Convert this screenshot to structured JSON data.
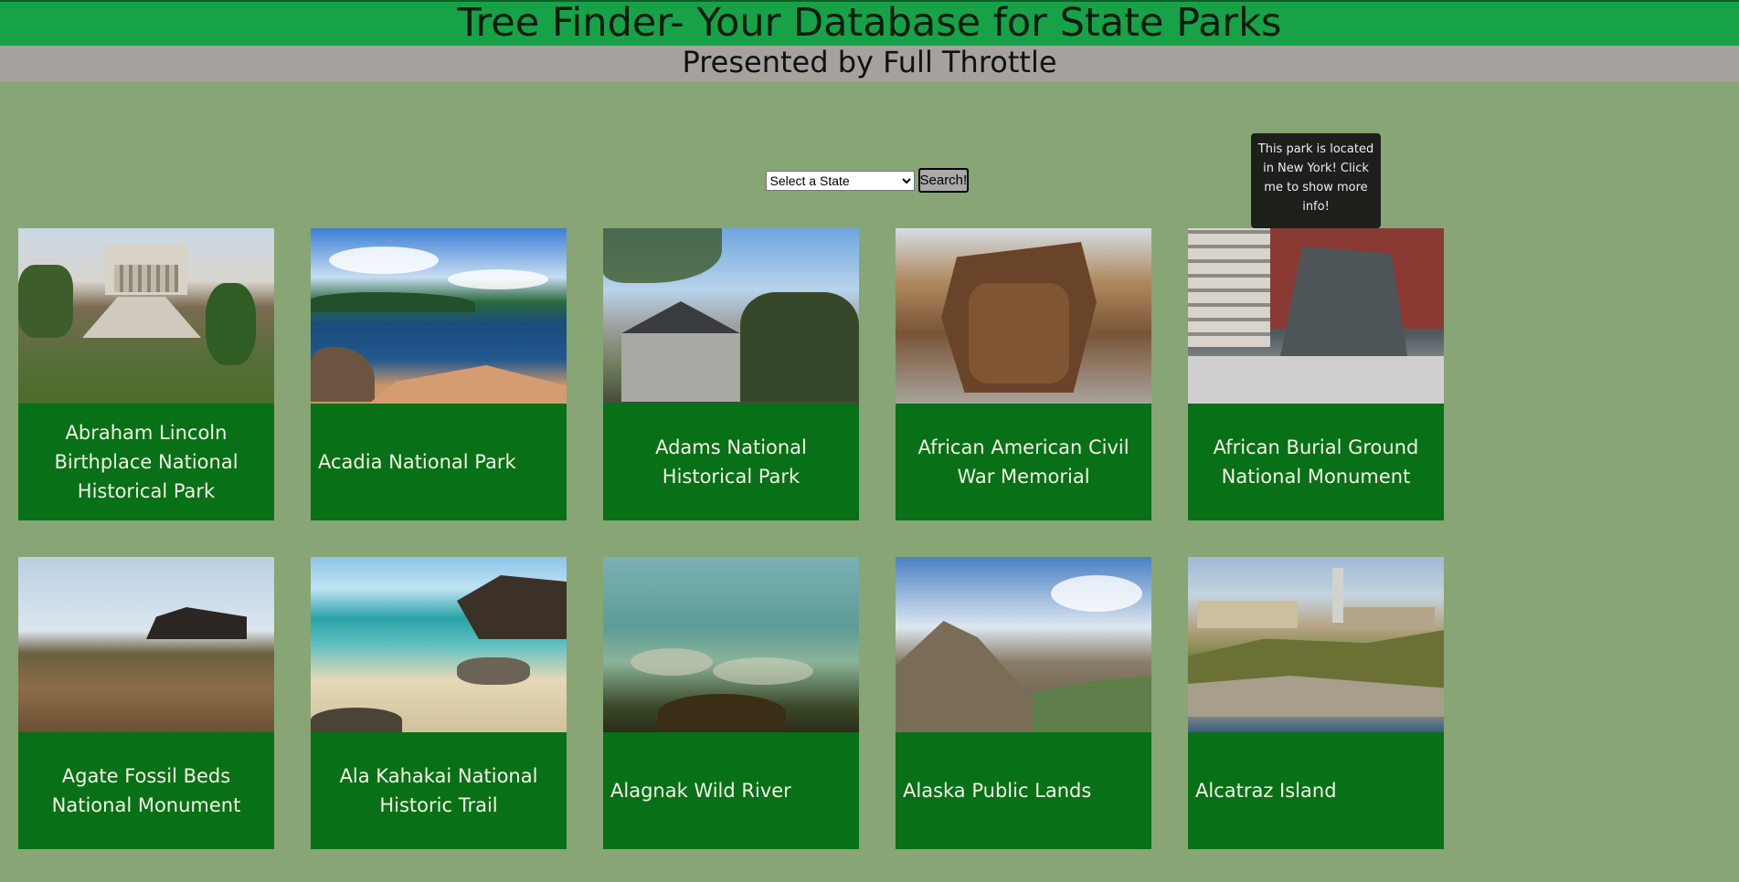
{
  "header": {
    "title": "Tree Finder- Your Database for State Parks",
    "subtitle": "Presented by Full Throttle"
  },
  "search": {
    "select_value": "Select a State",
    "button_label": "Search!"
  },
  "tooltip": {
    "text": "This park is located in New York! Click me to show more info!"
  },
  "parks": [
    {
      "name": "Abraham Lincoln Birthplace National Historical Park"
    },
    {
      "name": "Acadia National Park"
    },
    {
      "name": "Adams National Historical Park"
    },
    {
      "name": "African American Civil War Memorial"
    },
    {
      "name": "African Burial Ground National Monument"
    },
    {
      "name": "Agate Fossil Beds National Monument"
    },
    {
      "name": "Ala Kahakai National Historic Trail"
    },
    {
      "name": "Alagnak Wild River"
    },
    {
      "name": "Alaska Public Lands"
    },
    {
      "name": "Alcatraz Island"
    }
  ]
}
